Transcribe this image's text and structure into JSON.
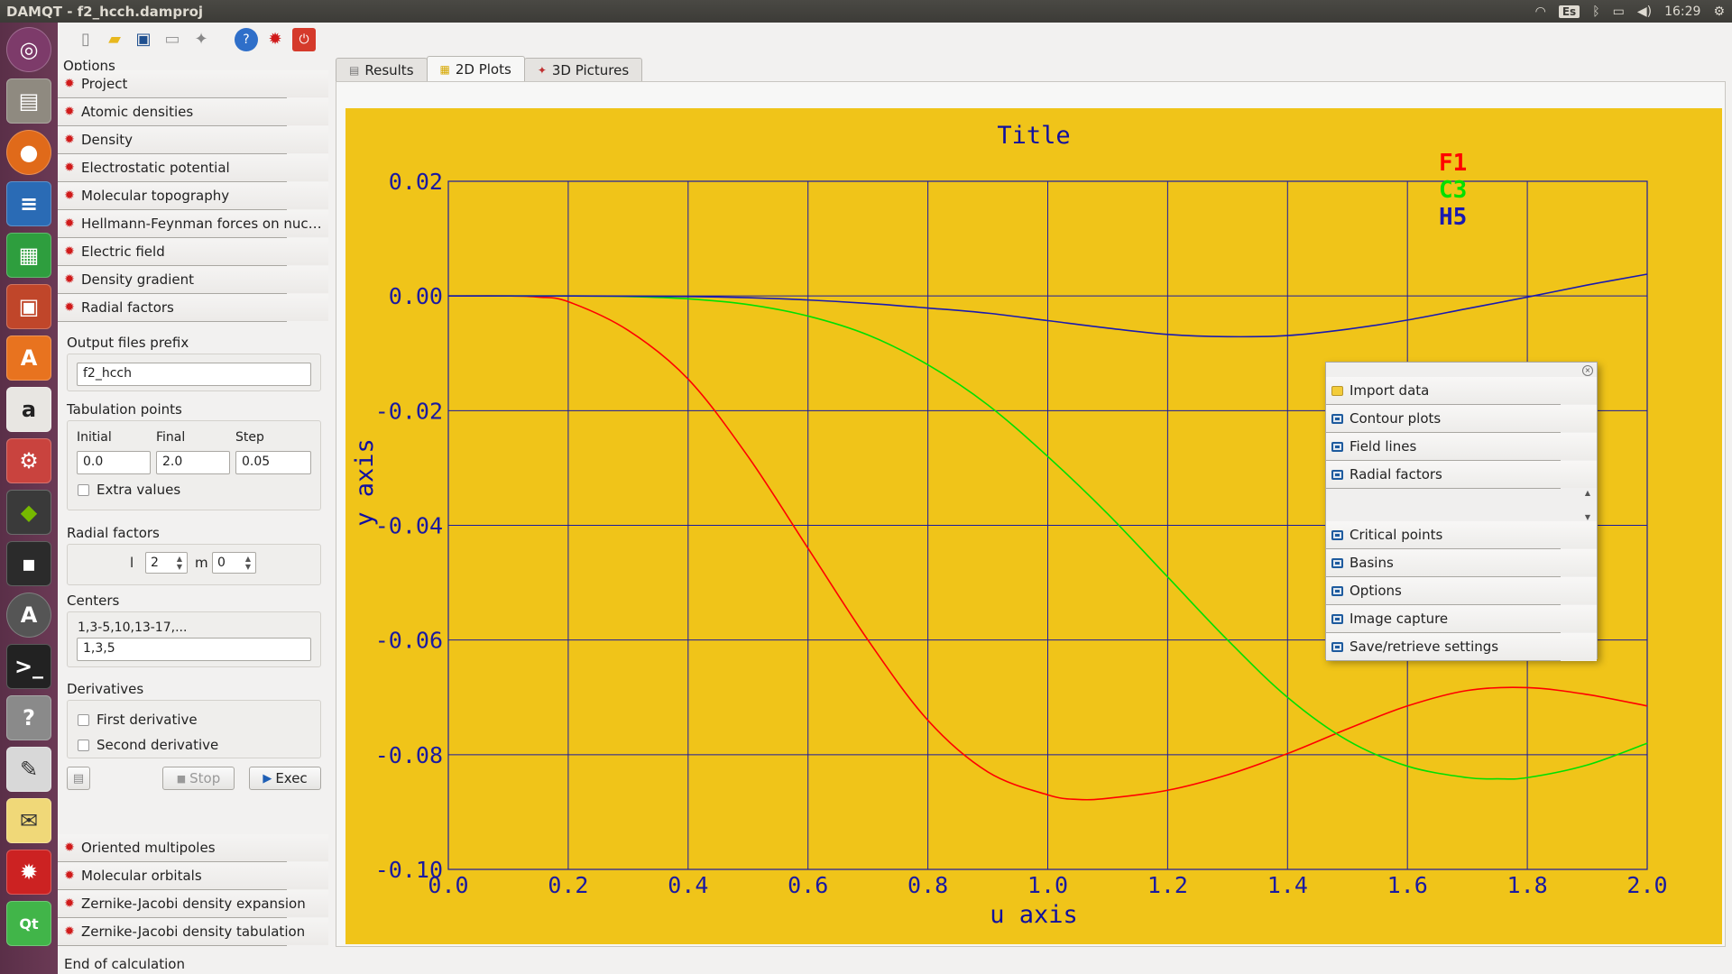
{
  "window": {
    "title": "DAMQT - f2_hcch.damproj"
  },
  "tray": {
    "keyboard": "Es",
    "time": "16:29"
  },
  "left": {
    "options_label": "Options",
    "sections_top": [
      "Project",
      "Atomic densities",
      "Density",
      "Electrostatic potential",
      "Molecular topography",
      "Hellmann-Feynman forces on nuc…",
      "Electric field",
      "Density gradient",
      "Radial factors"
    ],
    "output_prefix_label": "Output files prefix",
    "output_prefix_value": "f2_hcch",
    "tabulation_label": "Tabulation points",
    "initial_label": "Initial",
    "final_label": "Final",
    "step_label": "Step",
    "initial_value": "0.0",
    "final_value": "2.0",
    "step_value": "0.05",
    "extra_values": "Extra values",
    "radial_label": "Radial factors",
    "l_label": "l",
    "l_value": "2",
    "m_label": "m",
    "m_value": "0",
    "centers_label": "Centers",
    "centers_hint": "1,3-5,10,13-17,...",
    "centers_value": "1,3,5",
    "derivatives_label": "Derivatives",
    "first_derivative": "First derivative",
    "second_derivative": "Second derivative",
    "stop_label": "Stop",
    "exec_label": "Exec",
    "sections_bottom": [
      "Oriented multipoles",
      "Molecular orbitals",
      "Zernike-Jacobi density expansion",
      "Zernike-Jacobi density tabulation"
    ],
    "status": "End of calculation"
  },
  "tabs": [
    {
      "label": "Results"
    },
    {
      "label": "2D Plots"
    },
    {
      "label": "3D Pictures"
    }
  ],
  "chart_data": {
    "type": "line",
    "title": "Title",
    "xlabel": "u axis",
    "ylabel": "y axis",
    "xlim": [
      0.0,
      2.0
    ],
    "ylim": [
      -0.1,
      0.02
    ],
    "xticks": [
      "0.0",
      "0.2",
      "0.4",
      "0.6",
      "0.8",
      "1.0",
      "1.2",
      "1.4",
      "1.6",
      "1.8",
      "2.0"
    ],
    "yticks": [
      "0.02",
      "0.00",
      "-0.02",
      "-0.04",
      "-0.06",
      "-0.08",
      "-0.10"
    ],
    "grid": true,
    "legend_position": "top-right",
    "background": "#f0c419",
    "series": [
      {
        "name": "F1",
        "color": "#ff0000",
        "x": [
          0.0,
          0.1,
          0.15,
          0.2,
          0.3,
          0.4,
          0.5,
          0.6,
          0.7,
          0.8,
          0.9,
          1.0,
          1.05,
          1.1,
          1.2,
          1.3,
          1.4,
          1.5,
          1.6,
          1.7,
          1.8,
          1.9,
          2.0
        ],
        "y": [
          0.0,
          0.0,
          -0.0002,
          -0.001,
          -0.006,
          -0.0145,
          -0.028,
          -0.044,
          -0.06,
          -0.074,
          -0.083,
          -0.087,
          -0.0878,
          -0.0876,
          -0.0862,
          -0.0835,
          -0.0798,
          -0.0755,
          -0.0715,
          -0.0688,
          -0.0683,
          -0.0695,
          -0.0715
        ]
      },
      {
        "name": "C3",
        "color": "#00e000",
        "x": [
          0.0,
          0.2,
          0.3,
          0.4,
          0.5,
          0.6,
          0.7,
          0.8,
          0.9,
          1.0,
          1.1,
          1.2,
          1.3,
          1.4,
          1.5,
          1.6,
          1.7,
          1.75,
          1.8,
          1.9,
          2.0
        ],
        "y": [
          0.0,
          0.0,
          -0.0001,
          -0.0005,
          -0.0015,
          -0.0035,
          -0.0068,
          -0.012,
          -0.019,
          -0.028,
          -0.038,
          -0.049,
          -0.06,
          -0.07,
          -0.0775,
          -0.082,
          -0.084,
          -0.0842,
          -0.084,
          -0.0818,
          -0.078
        ]
      },
      {
        "name": "H5",
        "color": "#1a1ab0",
        "x": [
          0.0,
          0.2,
          0.4,
          0.5,
          0.6,
          0.7,
          0.8,
          0.9,
          1.0,
          1.1,
          1.2,
          1.3,
          1.4,
          1.5,
          1.6,
          1.7,
          1.8,
          1.9,
          2.0
        ],
        "y": [
          0.0,
          0.0,
          -0.0001,
          -0.0003,
          -0.0007,
          -0.0013,
          -0.0021,
          -0.003,
          -0.0043,
          -0.0056,
          -0.0067,
          -0.0071,
          -0.0069,
          -0.0058,
          -0.0042,
          -0.0022,
          -0.0002,
          0.0019,
          0.0038
        ]
      }
    ]
  },
  "float_menu": {
    "items": [
      "Import data",
      "Contour plots",
      "Field lines",
      "Radial factors",
      "Critical points",
      "Basins",
      "Options",
      "Image capture",
      "Save/retrieve settings"
    ]
  }
}
